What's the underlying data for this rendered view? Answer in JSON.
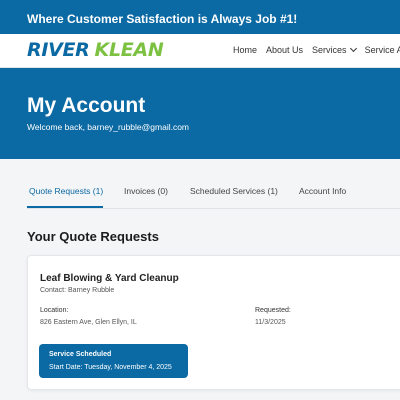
{
  "announcement": "Where Customer Satisfaction is Always Job #1!",
  "logo": {
    "part1": "RIVER",
    "part2": "KLEAN"
  },
  "nav": {
    "home": "Home",
    "about": "About Us",
    "services": "Services",
    "service_area": "Service Are"
  },
  "hero": {
    "title": "My Account",
    "welcome": "Welcome back, barney_rubble@gmail.com"
  },
  "tabs": [
    {
      "label": "Quote Requests (1)",
      "active": true
    },
    {
      "label": "Invoices (0)",
      "active": false
    },
    {
      "label": "Scheduled Services (1)",
      "active": false
    },
    {
      "label": "Account Info",
      "active": false
    }
  ],
  "section_title": "Your Quote Requests",
  "quote": {
    "title": "Leaf Blowing & Yard Cleanup",
    "contact": "Contact: Barney Rubble",
    "location_label": "Location:",
    "location_value": "826 Eastern Ave, Glen Ellyn, IL",
    "requested_label": "Requested:",
    "requested_value": "11/3/2025",
    "status_title": "Service Scheduled",
    "status_detail": "Start Date: Tuesday, November 4, 2025"
  },
  "colors": {
    "primary": "#0b69a3",
    "accent_green": "#7dc142"
  }
}
